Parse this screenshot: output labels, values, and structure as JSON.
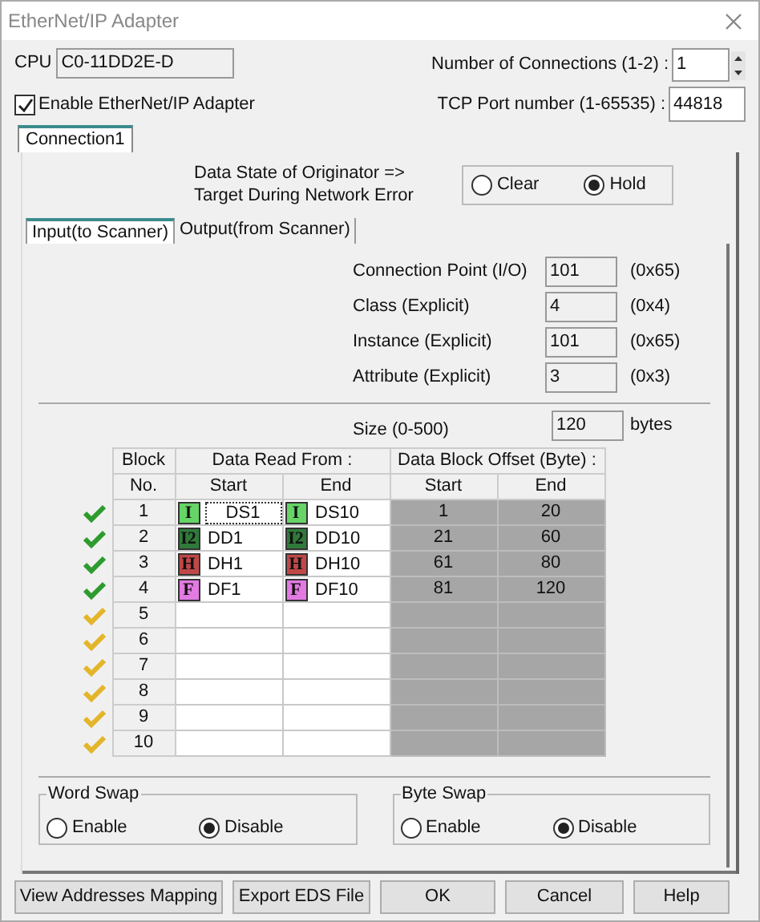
{
  "window": {
    "title": "EtherNet/IP Adapter"
  },
  "cpu": {
    "label": "CPU",
    "value": "C0-11DD2E-D"
  },
  "connections": {
    "label": "Number of Connections (1-2) :",
    "value": "1"
  },
  "enable": {
    "label": "Enable EtherNet/IP Adapter",
    "checked": true
  },
  "tcp_port": {
    "label": "TCP Port number (1-65535) :",
    "value": "44818"
  },
  "connection_tabs": [
    {
      "label": "Connection1",
      "selected": true
    }
  ],
  "data_state": {
    "label": "Data State of Originator =>",
    "label_2": "Target During Network Error",
    "options": [
      {
        "label": "Clear",
        "selected": false
      },
      {
        "label": "Hold",
        "selected": true
      }
    ]
  },
  "io_tabs": [
    {
      "label": "Input(to Scanner)",
      "selected": true
    },
    {
      "label": "Output(from Scanner)",
      "selected": false
    }
  ],
  "fields": [
    {
      "label": "Connection Point (I/O)",
      "value": "101",
      "hex": "(0x65)"
    },
    {
      "label": "Class (Explicit)",
      "value": "4",
      "hex": "(0x4)"
    },
    {
      "label": "Instance (Explicit)",
      "value": "101",
      "hex": "(0x65)"
    },
    {
      "label": "Attribute (Explicit)",
      "value": "3",
      "hex": "(0x3)"
    }
  ],
  "size": {
    "label": "Size (0-500)",
    "value": "120",
    "unit": "bytes"
  },
  "table": {
    "group_headers": [
      "Block",
      "Data Read From :",
      "Data Block Offset (Byte) :"
    ],
    "columns": [
      "No.",
      "Start",
      "End",
      "Start",
      "End"
    ],
    "rows": [
      {
        "no": "1",
        "valid": true,
        "focused": true,
        "start": {
          "tag": "I",
          "color": "#66d466",
          "address": "DS1"
        },
        "end": {
          "tag": "I",
          "color": "#66d466",
          "address": "DS10"
        },
        "offset_start": "1",
        "offset_end": "20"
      },
      {
        "no": "2",
        "valid": true,
        "focused": false,
        "start": {
          "tag": "I2",
          "color": "#2f7a3a",
          "address": "DD1"
        },
        "end": {
          "tag": "I2",
          "color": "#2f7a3a",
          "address": "DD10"
        },
        "offset_start": "21",
        "offset_end": "60"
      },
      {
        "no": "3",
        "valid": true,
        "focused": false,
        "start": {
          "tag": "H",
          "color": "#c04848",
          "address": "DH1"
        },
        "end": {
          "tag": "H",
          "color": "#c04848",
          "address": "DH10"
        },
        "offset_start": "61",
        "offset_end": "80"
      },
      {
        "no": "4",
        "valid": true,
        "focused": false,
        "start": {
          "tag": "F",
          "color": "#e27ae2",
          "address": "DF1"
        },
        "end": {
          "tag": "F",
          "color": "#e27ae2",
          "address": "DF10"
        },
        "offset_start": "81",
        "offset_end": "120"
      },
      {
        "no": "5",
        "valid": false,
        "focused": false
      },
      {
        "no": "6",
        "valid": false,
        "focused": false
      },
      {
        "no": "7",
        "valid": false,
        "focused": false
      },
      {
        "no": "8",
        "valid": false,
        "focused": false
      },
      {
        "no": "9",
        "valid": false,
        "focused": false
      },
      {
        "no": "10",
        "valid": false,
        "focused": false
      }
    ]
  },
  "word_swap": {
    "title": "Word Swap",
    "options": [
      {
        "label": "Enable",
        "selected": false
      },
      {
        "label": "Disable",
        "selected": true
      }
    ]
  },
  "byte_swap": {
    "title": "Byte Swap",
    "options": [
      {
        "label": "Enable",
        "selected": false
      },
      {
        "label": "Disable",
        "selected": true
      }
    ]
  },
  "buttons": [
    "View Addresses Mapping",
    "Export EDS File",
    "OK",
    "Cancel",
    "Help"
  ]
}
